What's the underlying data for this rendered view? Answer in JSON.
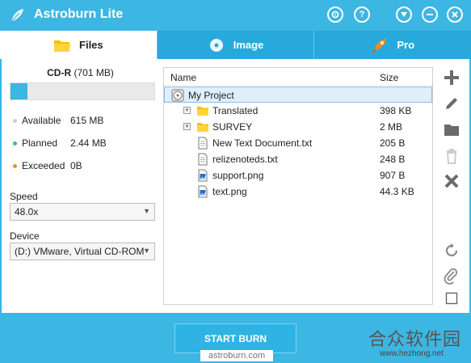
{
  "app": {
    "title": "Astroburn Lite"
  },
  "titlebar_buttons": [
    "settings-icon",
    "help-icon",
    "dropdown-icon",
    "minimize-icon",
    "close-icon"
  ],
  "tabs": [
    {
      "label": "Files",
      "icon": "folder-icon",
      "active": true
    },
    {
      "label": "Image",
      "icon": "disc-image-icon",
      "active": false
    },
    {
      "label": "Pro",
      "icon": "rocket-icon",
      "active": false
    }
  ],
  "disc": {
    "type": "CD-R",
    "capacity": "(701 MB)",
    "used_fraction": 0.12,
    "stats": [
      {
        "label": "Available",
        "value": "615 MB",
        "color": "#cfcfcf"
      },
      {
        "label": "Planned",
        "value": "2.44 MB",
        "color": "#2bbf9a"
      },
      {
        "label": "Exceeded",
        "value": "0B",
        "color": "#f08a2c"
      }
    ]
  },
  "speed": {
    "label": "Speed",
    "value": "48.0x"
  },
  "device": {
    "label": "Device",
    "value": "(D:) VMware, Virtual CD-ROM"
  },
  "file_list": {
    "columns": {
      "name": "Name",
      "size": "Size"
    },
    "rows": [
      {
        "name": "My Project",
        "size": "",
        "icon": "disc-icon",
        "level": 0,
        "expander": false,
        "selected": true
      },
      {
        "name": "Translated",
        "size": "398 KB",
        "icon": "folder-icon",
        "level": 1,
        "expander": true,
        "selected": false
      },
      {
        "name": "SURVEY",
        "size": "2 MB",
        "icon": "folder-icon",
        "level": 1,
        "expander": true,
        "selected": false
      },
      {
        "name": "New Text Document.txt",
        "size": "205 B",
        "icon": "text-file-icon",
        "level": 1,
        "expander": false,
        "selected": false
      },
      {
        "name": "relizenoteds.txt",
        "size": "248 B",
        "icon": "text-file-icon",
        "level": 1,
        "expander": false,
        "selected": false
      },
      {
        "name": "support.png",
        "size": "907 B",
        "icon": "image-file-icon",
        "level": 1,
        "expander": false,
        "selected": false
      },
      {
        "name": "text.png",
        "size": "44.3 KB",
        "icon": "image-file-icon",
        "level": 1,
        "expander": false,
        "selected": false
      }
    ]
  },
  "side_tools": [
    "add-icon",
    "rename-icon",
    "new-folder-icon",
    "delete-icon",
    "remove-all-icon",
    "refresh-icon",
    "attach-icon",
    "checkbox-icon"
  ],
  "burn_button": {
    "label": "START BURN"
  },
  "website": "astroburn.com",
  "watermark": {
    "text": "合众软件园",
    "url": "www.hezhong.net"
  },
  "colors": {
    "accent": "#3cb6e2",
    "tab_inactive": "#28a9dc",
    "folder": "#f5c100"
  }
}
